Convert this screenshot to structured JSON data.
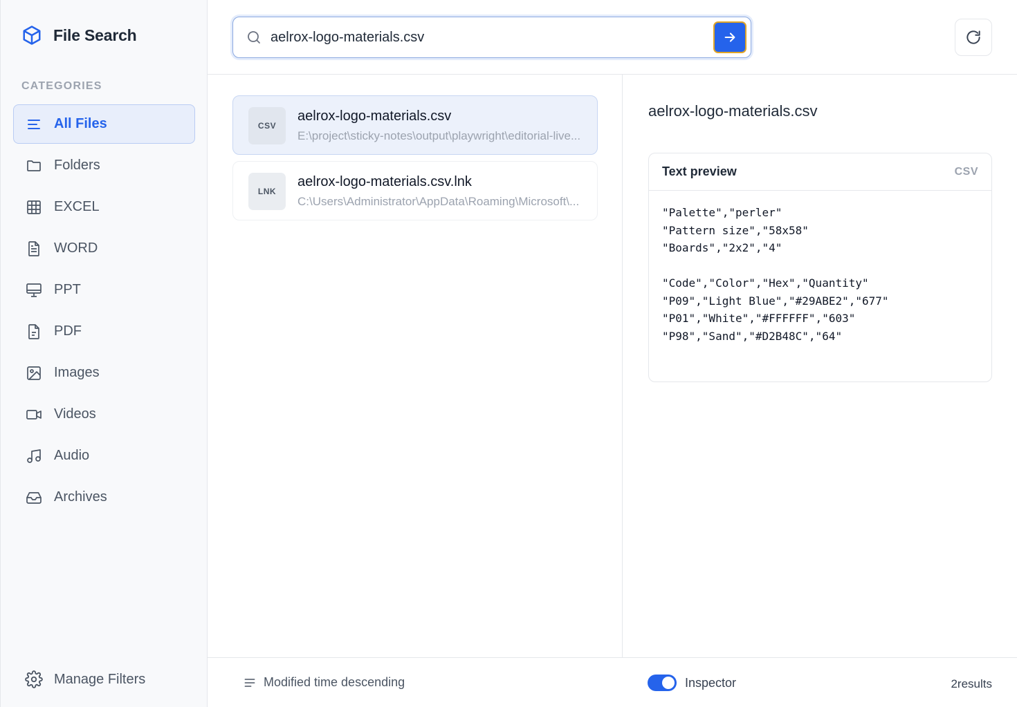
{
  "app": {
    "title": "File Search"
  },
  "sidebar": {
    "heading": "CATEGORIES",
    "items": [
      {
        "label": "All Files",
        "icon": "list-icon",
        "active": true
      },
      {
        "label": "Folders",
        "icon": "folder-icon"
      },
      {
        "label": "EXCEL",
        "icon": "table-icon"
      },
      {
        "label": "WORD",
        "icon": "document-icon"
      },
      {
        "label": "PPT",
        "icon": "presentation-icon"
      },
      {
        "label": "PDF",
        "icon": "pdf-icon"
      },
      {
        "label": "Images",
        "icon": "image-icon"
      },
      {
        "label": "Videos",
        "icon": "video-icon"
      },
      {
        "label": "Audio",
        "icon": "music-icon"
      },
      {
        "label": "Archives",
        "icon": "inbox-icon"
      }
    ],
    "manage_label": "Manage Filters"
  },
  "search": {
    "value": "aelrox-logo-materials.csv"
  },
  "results": [
    {
      "ext": "CSV",
      "name": "aelrox-logo-materials.csv",
      "path": "E:\\project\\sticky-notes\\output\\playwright\\editorial-live...",
      "selected": true
    },
    {
      "ext": "LNK",
      "name": "aelrox-logo-materials.csv.lnk",
      "path": "C:\\Users\\Administrator\\AppData\\Roaming\\Microsoft\\...",
      "selected": false
    }
  ],
  "inspector": {
    "title": "aelrox-logo-materials.csv",
    "preview_title": "Text preview",
    "preview_type": "CSV",
    "preview_text": "\"Palette\",\"perler\"\n\"Pattern size\",\"58x58\"\n\"Boards\",\"2x2\",\"4\"\n\n\"Code\",\"Color\",\"Hex\",\"Quantity\"\n\"P09\",\"Light Blue\",\"#29ABE2\",\"677\"\n\"P01\",\"White\",\"#FFFFFF\",\"603\"\n\"P98\",\"Sand\",\"#D2B48C\",\"64\""
  },
  "footer": {
    "sort_label": "Modified time descending",
    "inspector_label": "Inspector",
    "inspector_on": true,
    "result_count": "2results"
  },
  "colors": {
    "accent": "#2563eb",
    "focus_ring": "#e0a526"
  }
}
